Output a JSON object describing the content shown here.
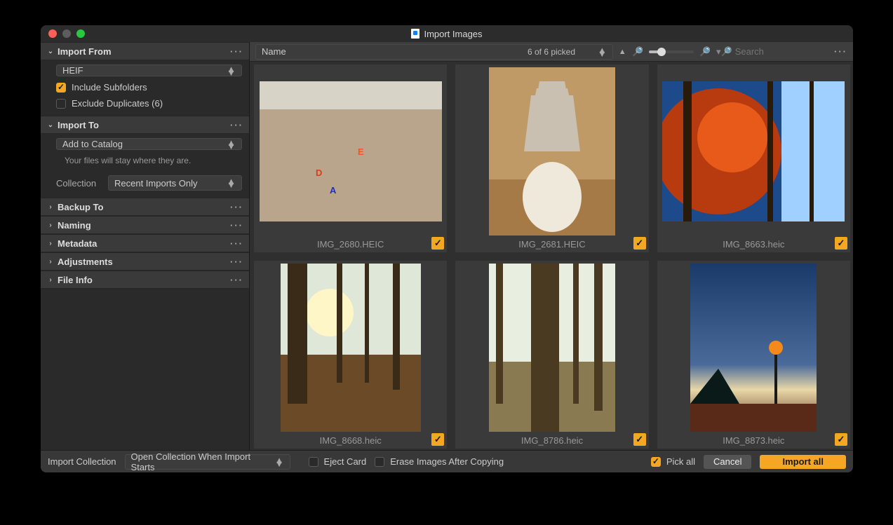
{
  "window": {
    "title": "Import Images"
  },
  "sidebar": {
    "import_from": {
      "title": "Import From",
      "source": "HEIF",
      "include_subfolders": "Include Subfolders",
      "exclude_duplicates": "Exclude Duplicates (6)"
    },
    "import_to": {
      "title": "Import To",
      "action": "Add to Catalog",
      "note": "Your files will stay where they are.",
      "collection_label": "Collection",
      "collection": "Recent Imports Only"
    },
    "backup_to": "Backup To",
    "naming": "Naming",
    "metadata": "Metadata",
    "adjustments": "Adjustments",
    "file_info": "File Info"
  },
  "toolbar": {
    "sort_by": "Name",
    "picked": "6 of 6 picked",
    "search_placeholder": "Search"
  },
  "thumbnails": [
    {
      "filename": "IMG_2680.HEIC"
    },
    {
      "filename": "IMG_2681.HEIC"
    },
    {
      "filename": "IMG_8663.heic"
    },
    {
      "filename": "IMG_8668.heic"
    },
    {
      "filename": "IMG_8786.heic"
    },
    {
      "filename": "IMG_8873.heic"
    }
  ],
  "footer": {
    "import_collection_label": "Import Collection",
    "import_collection": "Open Collection When Import Starts",
    "eject_card": "Eject Card",
    "erase_after": "Erase Images After Copying",
    "pick_all": "Pick all",
    "cancel": "Cancel",
    "import_all": "Import all"
  }
}
